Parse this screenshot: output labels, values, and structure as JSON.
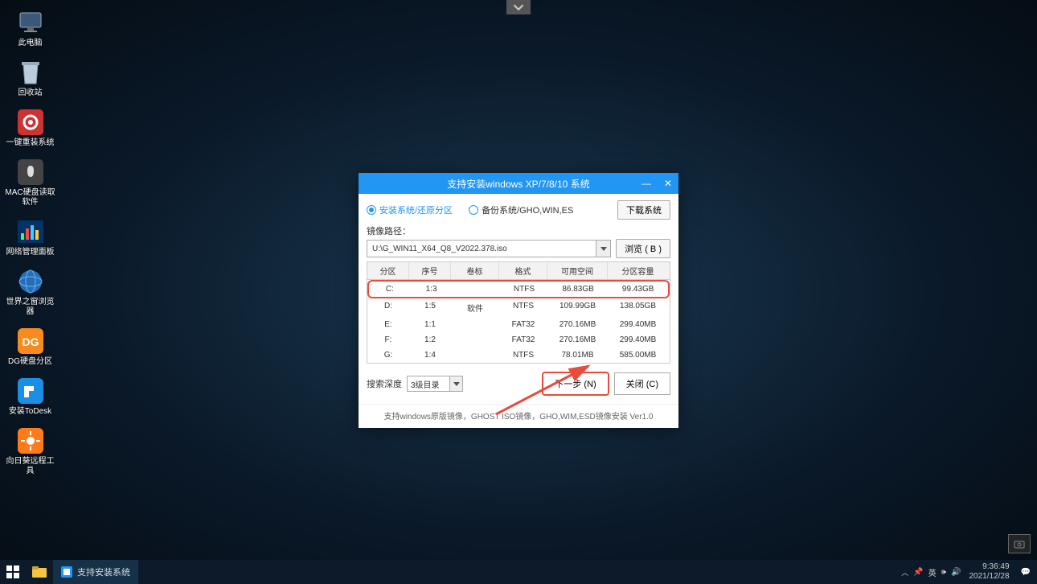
{
  "top_notch": {
    "icon": "chevron-down"
  },
  "desktop_icons": [
    {
      "name": "此电脑",
      "type": "pc"
    },
    {
      "name": "回收站",
      "type": "bin"
    },
    {
      "name": "一键重装系统",
      "type": "gear"
    },
    {
      "name": "MAC硬盘读取软件",
      "type": "apple"
    },
    {
      "name": "网络管理面板",
      "type": "chart"
    },
    {
      "name": "世界之窗浏览器",
      "type": "globe"
    },
    {
      "name": "DG硬盘分区",
      "type": "dg"
    },
    {
      "name": "安装ToDesk",
      "type": "todesk"
    },
    {
      "name": "向日葵远程工具",
      "type": "sunflower"
    }
  ],
  "dialog": {
    "title": "支持安装windows XP/7/8/10 系统",
    "radio1": "安装系统/还原分区",
    "radio2": "备份系统/GHO,WIN,ES",
    "download_btn": "下载系统",
    "path_label": "镜像路径：",
    "path_value": "U:\\G_WIN11_X64_Q8_V2022.378.iso",
    "browse_btn": "浏览 ( B )",
    "columns": [
      "分区",
      "序号",
      "卷标",
      "格式",
      "可用空间",
      "分区容量"
    ],
    "rows": [
      {
        "p": "C:",
        "n": "1:3",
        "l": "",
        "f": "NTFS",
        "a": "86.83GB",
        "c": "99.43GB",
        "hl": true
      },
      {
        "p": "D:",
        "n": "1:5",
        "l": "软件",
        "f": "NTFS",
        "a": "109.99GB",
        "c": "138.05GB"
      },
      {
        "p": "E:",
        "n": "1:1",
        "l": "",
        "f": "FAT32",
        "a": "270.16MB",
        "c": "299.40MB"
      },
      {
        "p": "F:",
        "n": "1:2",
        "l": "",
        "f": "FAT32",
        "a": "270.16MB",
        "c": "299.40MB"
      },
      {
        "p": "G:",
        "n": "1:4",
        "l": "",
        "f": "NTFS",
        "a": "78.01MB",
        "c": "585.00MB"
      }
    ],
    "depth_label": "搜索深度",
    "depth_value": "3级目录",
    "next_btn": "下一步 (N)",
    "close_btn": "关闭 (C)",
    "footer": "支持windows原版镜像，GHOST ISO镜像，GHO,WIM,ESD镜像安装 Ver1.0"
  },
  "taskbar": {
    "app_label": "支持安装系统",
    "tray": {
      "ime": "英",
      "sound": "🔊",
      "net": "📶"
    },
    "time": "9:36:49",
    "date": "2021/12/28"
  }
}
